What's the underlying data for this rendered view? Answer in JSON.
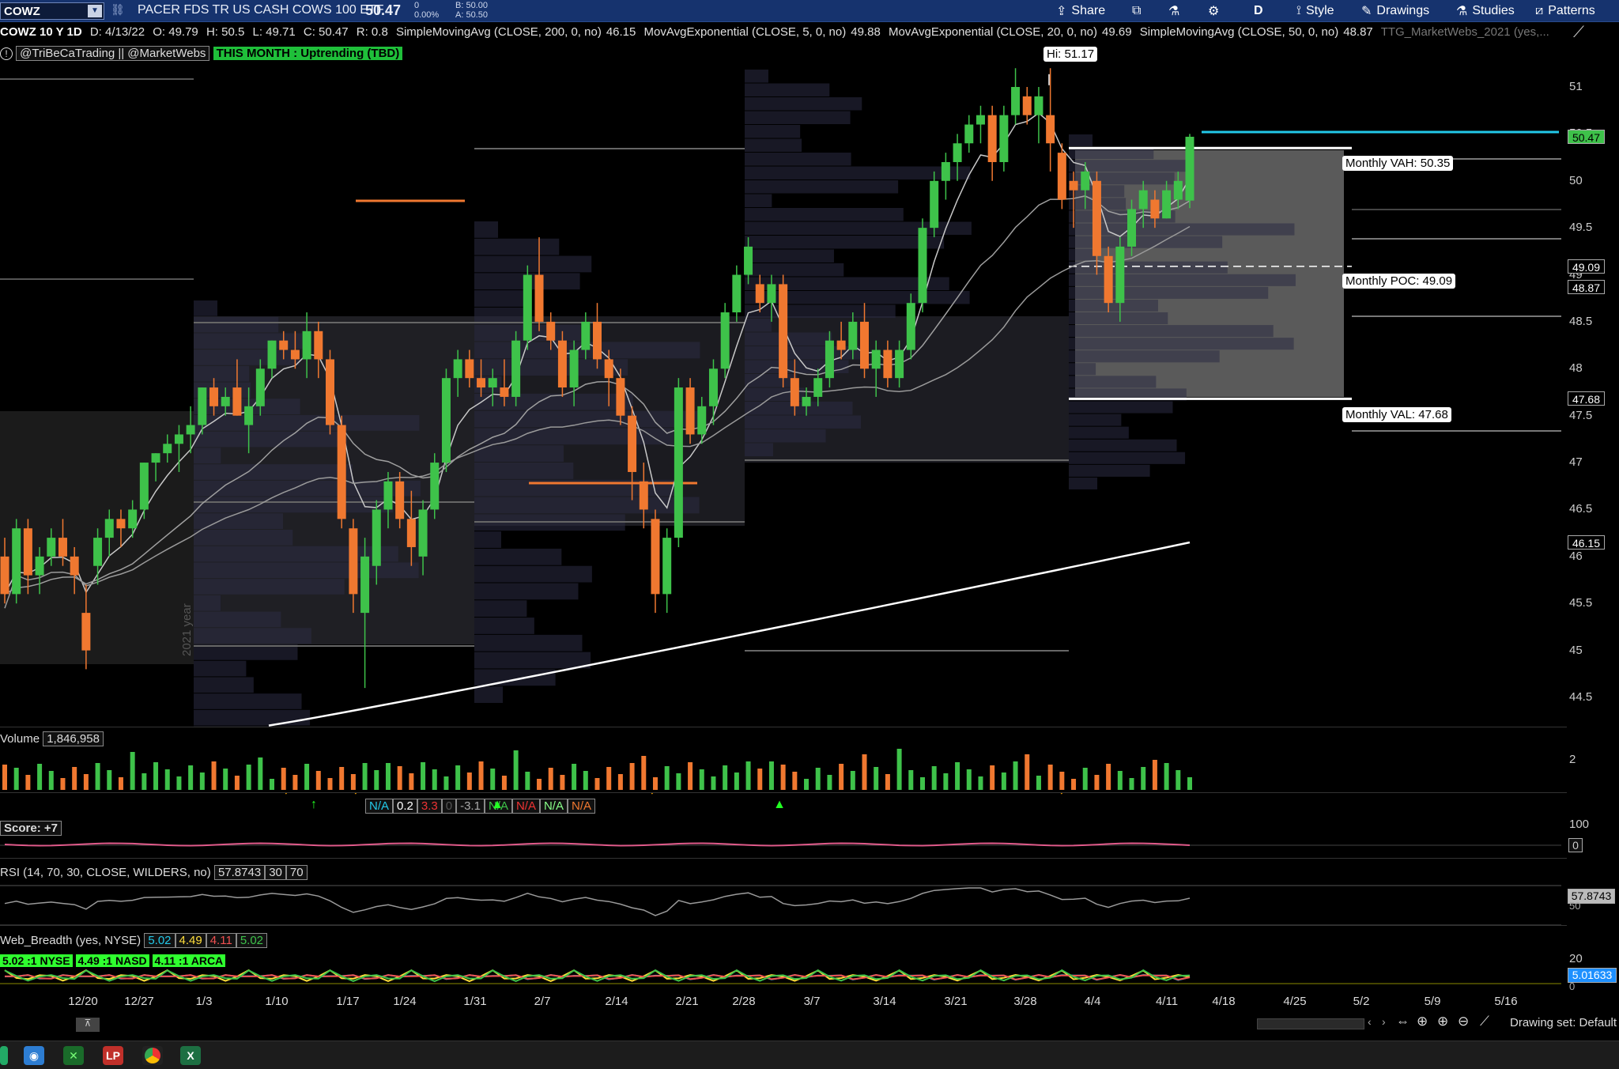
{
  "topbar": {
    "symbol": "COWZ",
    "description": "PACER FDS TR US CASH COWS 100 ETF",
    "last": "50.47",
    "change": "0",
    "change_pct": "0.00%",
    "bid": "B: 50.00",
    "ask": "A: 50.50",
    "buttons": {
      "share": "Share",
      "style": "Style",
      "drawings": "Drawings",
      "studies": "Studies",
      "patterns": "Patterns",
      "period": "D"
    }
  },
  "studyline": {
    "chart_id": "COWZ 10 Y 1D",
    "date": "D: 4/13/22",
    "open": "O: 49.79",
    "high": "H: 50.5",
    "low": "L: 49.71",
    "close": "C: 50.47",
    "range": "R: 0.8",
    "sma200": "SimpleMovingAvg (CLOSE, 200, 0, no)",
    "sma200_val": "46.15",
    "ema5": "MovAvgExponential (CLOSE, 5, 0, no)",
    "ema5_val": "49.88",
    "ema20": "MovAvgExponential (CLOSE, 20, 0, no)",
    "ema20_val": "49.69",
    "sma50": "SimpleMovingAvg (CLOSE, 50, 0, no)",
    "sma50_val": "48.87",
    "ttg": "TTG_MarketWebs_2021 (yes,..."
  },
  "tags": {
    "handles": "@TriBeCaTrading || @MarketWebs",
    "month": "THIS MONTH : Uptrending (TBD)",
    "year_watermark": "2021 year"
  },
  "annotations": {
    "hi": "Hi: 51.17",
    "vah": "Monthly VAH: 50.35",
    "poc": "Monthly POC: 49.09",
    "val": "Monthly VAL: 47.68"
  },
  "price_axis": {
    "ticks": [
      "51",
      "50.5",
      "50",
      "49.5",
      "49",
      "48.5",
      "48",
      "47.5",
      "47",
      "46.5",
      "46",
      "45.5",
      "45",
      "44.5"
    ],
    "badges": [
      {
        "text": "50.47",
        "color": "#3ec24a"
      },
      {
        "text": "49.09",
        "color": "#000000"
      },
      {
        "text": "48.87",
        "color": "#000000"
      },
      {
        "text": "47.68",
        "color": "#000000"
      },
      {
        "text": "46.15",
        "color": "#000000"
      }
    ]
  },
  "volume": {
    "label": "Volume",
    "value": "1,846,958",
    "axis_ticks": [
      "2"
    ]
  },
  "score_row": {
    "values": [
      "N/A",
      "0.2",
      "3.3",
      "0",
      "-3.1",
      "N/A",
      "N/A",
      "N/A",
      "N/A"
    ],
    "label": "Score: +7",
    "axis_top": "100",
    "axis_badge": "0"
  },
  "rsi": {
    "label": "RSI (14, 70, 30, CLOSE, WILDERS, no)",
    "value": "57.8743",
    "lo": "30",
    "hi": "70",
    "badge": "57.8743",
    "axis_tick": "50"
  },
  "breadth": {
    "label": "Web_Breadth (yes, NYSE)",
    "v1": "5.02",
    "v2": "4.49",
    "v3": "4.11",
    "v4": "5.02",
    "nyse": "5.02 :1 NYSE",
    "nasd": "4.49 :1 NASD",
    "arca": "4.11 :1 ARCA",
    "axis_top": "20",
    "axis_bottom": "0",
    "badge": "5.01633"
  },
  "x_axis": [
    "12/20",
    "12/27",
    "1/3",
    "1/10",
    "1/17",
    "1/24",
    "1/31",
    "2/7",
    "2/14",
    "2/21",
    "2/28",
    "3/7",
    "3/14",
    "3/21",
    "3/28",
    "4/4",
    "4/11",
    "4/18",
    "4/25",
    "5/2",
    "5/9",
    "5/16"
  ],
  "footer": {
    "drawing_set": "Drawing set: Default"
  },
  "colors": {
    "up": "#3ec24a",
    "down": "#f07830",
    "topbar": "#16336e",
    "accent_cyan": "#22c8e8"
  },
  "chart_data": {
    "type": "candlestick",
    "ylim": [
      44.2,
      51.4
    ],
    "candles": [
      [
        46.0,
        46.2,
        45.5,
        45.6
      ],
      [
        45.6,
        46.4,
        45.5,
        46.3
      ],
      [
        46.3,
        46.4,
        45.6,
        45.8
      ],
      [
        45.8,
        46.1,
        45.6,
        46.0
      ],
      [
        46.0,
        46.3,
        45.9,
        46.2
      ],
      [
        46.2,
        46.4,
        45.9,
        46.0
      ],
      [
        46.0,
        46.1,
        45.6,
        45.8
      ],
      [
        45.4,
        45.7,
        44.8,
        45.0
      ],
      [
        45.9,
        46.3,
        45.7,
        46.2
      ],
      [
        46.2,
        46.5,
        46.0,
        46.4
      ],
      [
        46.4,
        46.5,
        46.1,
        46.3
      ],
      [
        46.3,
        46.6,
        46.2,
        46.5
      ],
      [
        46.5,
        47.0,
        46.4,
        47.0
      ],
      [
        47.0,
        47.1,
        46.8,
        47.1
      ],
      [
        47.1,
        47.3,
        47.0,
        47.2
      ],
      [
        47.2,
        47.4,
        46.9,
        47.3
      ],
      [
        47.3,
        47.6,
        47.1,
        47.4
      ],
      [
        47.4,
        47.8,
        47.3,
        47.8
      ],
      [
        47.8,
        47.9,
        47.5,
        47.6
      ],
      [
        47.6,
        47.8,
        47.5,
        47.7
      ],
      [
        47.8,
        48.1,
        47.5,
        47.5
      ],
      [
        47.4,
        47.8,
        47.1,
        47.6
      ],
      [
        47.6,
        48.1,
        47.5,
        48.0
      ],
      [
        48.0,
        48.3,
        47.9,
        48.3
      ],
      [
        48.3,
        48.4,
        48.1,
        48.2
      ],
      [
        48.2,
        48.4,
        48.0,
        48.1
      ],
      [
        48.1,
        48.6,
        47.9,
        48.4
      ],
      [
        48.4,
        48.5,
        47.9,
        48.1
      ],
      [
        48.1,
        48.2,
        47.3,
        47.4
      ],
      [
        47.4,
        47.5,
        46.3,
        46.4
      ],
      [
        46.3,
        46.4,
        45.4,
        45.6
      ],
      [
        45.4,
        46.2,
        44.6,
        46.0
      ],
      [
        45.9,
        46.6,
        45.7,
        46.5
      ],
      [
        46.5,
        46.9,
        46.3,
        46.8
      ],
      [
        46.8,
        46.9,
        46.3,
        46.4
      ],
      [
        46.4,
        46.7,
        45.9,
        46.1
      ],
      [
        46.0,
        46.6,
        45.8,
        46.5
      ],
      [
        46.5,
        47.1,
        46.4,
        47.0
      ],
      [
        47.0,
        48.0,
        46.9,
        47.9
      ],
      [
        47.9,
        48.2,
        47.7,
        48.1
      ],
      [
        48.1,
        48.2,
        47.8,
        47.9
      ],
      [
        47.9,
        48.1,
        47.7,
        47.8
      ],
      [
        47.8,
        48.0,
        47.6,
        47.9
      ],
      [
        47.8,
        48.1,
        47.6,
        47.7
      ],
      [
        47.7,
        48.4,
        47.6,
        48.3
      ],
      [
        48.3,
        49.1,
        48.2,
        49.0
      ],
      [
        49.0,
        49.4,
        48.4,
        48.5
      ],
      [
        48.5,
        48.6,
        48.2,
        48.3
      ],
      [
        48.3,
        48.4,
        47.7,
        47.8
      ],
      [
        47.8,
        48.3,
        47.6,
        48.2
      ],
      [
        48.2,
        48.6,
        48.1,
        48.5
      ],
      [
        48.5,
        48.7,
        48.0,
        48.1
      ],
      [
        48.1,
        48.2,
        47.6,
        47.9
      ],
      [
        47.9,
        48.0,
        47.4,
        47.5
      ],
      [
        47.5,
        47.6,
        46.6,
        46.9
      ],
      [
        46.8,
        47.0,
        46.3,
        46.5
      ],
      [
        46.4,
        46.5,
        45.4,
        45.6
      ],
      [
        45.6,
        46.3,
        45.4,
        46.2
      ],
      [
        46.2,
        47.9,
        46.1,
        47.8
      ],
      [
        47.8,
        47.9,
        47.2,
        47.3
      ],
      [
        47.3,
        47.7,
        47.2,
        47.6
      ],
      [
        47.6,
        48.1,
        47.4,
        48.0
      ],
      [
        48.0,
        48.7,
        47.9,
        48.6
      ],
      [
        48.6,
        49.1,
        48.5,
        49.0
      ],
      [
        49.0,
        49.4,
        48.9,
        49.3
      ],
      [
        48.9,
        49.0,
        48.6,
        48.7
      ],
      [
        48.7,
        49.0,
        48.5,
        48.9
      ],
      [
        48.9,
        49.0,
        47.8,
        47.9
      ],
      [
        47.9,
        48.1,
        47.5,
        47.6
      ],
      [
        47.6,
        47.8,
        47.5,
        47.7
      ],
      [
        47.7,
        48.0,
        47.6,
        47.9
      ],
      [
        47.9,
        48.4,
        47.8,
        48.3
      ],
      [
        48.3,
        48.5,
        48.1,
        48.2
      ],
      [
        48.2,
        48.6,
        48.1,
        48.5
      ],
      [
        48.5,
        48.7,
        47.9,
        48.0
      ],
      [
        48.0,
        48.3,
        47.7,
        48.2
      ],
      [
        48.2,
        48.3,
        47.8,
        47.9
      ],
      [
        47.9,
        48.3,
        47.8,
        48.2
      ],
      [
        48.2,
        48.8,
        48.1,
        48.7
      ],
      [
        48.7,
        49.6,
        48.6,
        49.5
      ],
      [
        49.5,
        50.1,
        49.4,
        50.0
      ],
      [
        50.0,
        50.3,
        49.8,
        50.2
      ],
      [
        50.2,
        50.5,
        50.0,
        50.4
      ],
      [
        50.4,
        50.7,
        50.3,
        50.6
      ],
      [
        50.6,
        50.8,
        50.4,
        50.7
      ],
      [
        50.7,
        50.8,
        50.0,
        50.2
      ],
      [
        50.2,
        50.8,
        50.1,
        50.7
      ],
      [
        50.7,
        51.2,
        50.6,
        51.0
      ],
      [
        50.9,
        51.0,
        50.6,
        50.7
      ],
      [
        50.7,
        51.0,
        50.4,
        50.9
      ],
      [
        50.7,
        51.2,
        50.1,
        50.4
      ],
      [
        50.3,
        50.4,
        49.7,
        49.8
      ],
      [
        50.0,
        50.1,
        49.5,
        49.9
      ],
      [
        49.9,
        50.2,
        49.7,
        50.1
      ],
      [
        50.0,
        50.1,
        49.0,
        49.2
      ],
      [
        49.2,
        49.3,
        48.6,
        48.7
      ],
      [
        48.7,
        49.4,
        48.5,
        49.3
      ],
      [
        49.3,
        49.8,
        49.2,
        49.7
      ],
      [
        49.7,
        50.0,
        49.5,
        49.9
      ],
      [
        49.8,
        49.9,
        49.5,
        49.6
      ],
      [
        49.6,
        50.0,
        49.6,
        49.9
      ],
      [
        49.8,
        50.1,
        49.7,
        50.0
      ],
      [
        49.79,
        50.5,
        49.71,
        50.47
      ]
    ],
    "sma200_end": 46.15,
    "ema5_last": 49.88,
    "ema20_last": 49.69,
    "sma50_last": 48.87,
    "monthly_vah": 50.35,
    "monthly_poc": 49.09,
    "monthly_val": 47.68,
    "high_marker": 51.17
  }
}
